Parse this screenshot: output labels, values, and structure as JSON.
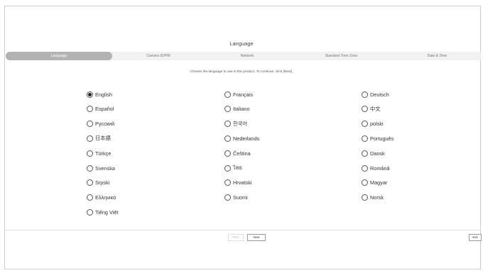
{
  "header": {
    "title": "Language"
  },
  "steps": [
    {
      "label": "Language",
      "active": true
    },
    {
      "label": "Camera ID/PW",
      "active": false
    },
    {
      "label": "Network",
      "active": false
    },
    {
      "label": "Standard Time Zone",
      "active": false
    },
    {
      "label": "Date & Time",
      "active": false
    }
  ],
  "instruction": "Choose the language to use in the product. To continue, click [Next].",
  "selected_language": "English",
  "languages": [
    "English",
    "Français",
    "Deutsch",
    "Español",
    "Italiano",
    "中文",
    "Русский",
    "한국어",
    "polski",
    "日本語",
    "Nederlands",
    "Português",
    "Türkçe",
    "Čeština",
    "Dansk",
    "Svenska",
    "ไทย",
    "Română",
    "Srpski",
    "Hrvatski",
    "Magyar",
    "Ελληνικά",
    "Suomi",
    "Norsk",
    "Tiếng Việt"
  ],
  "footer": {
    "prev_label": "Prev",
    "next_label": "Next",
    "exit_label": "Exit"
  },
  "colors": {
    "active_step": "#b3b3b3",
    "step_bar": "#f1f1f1"
  }
}
